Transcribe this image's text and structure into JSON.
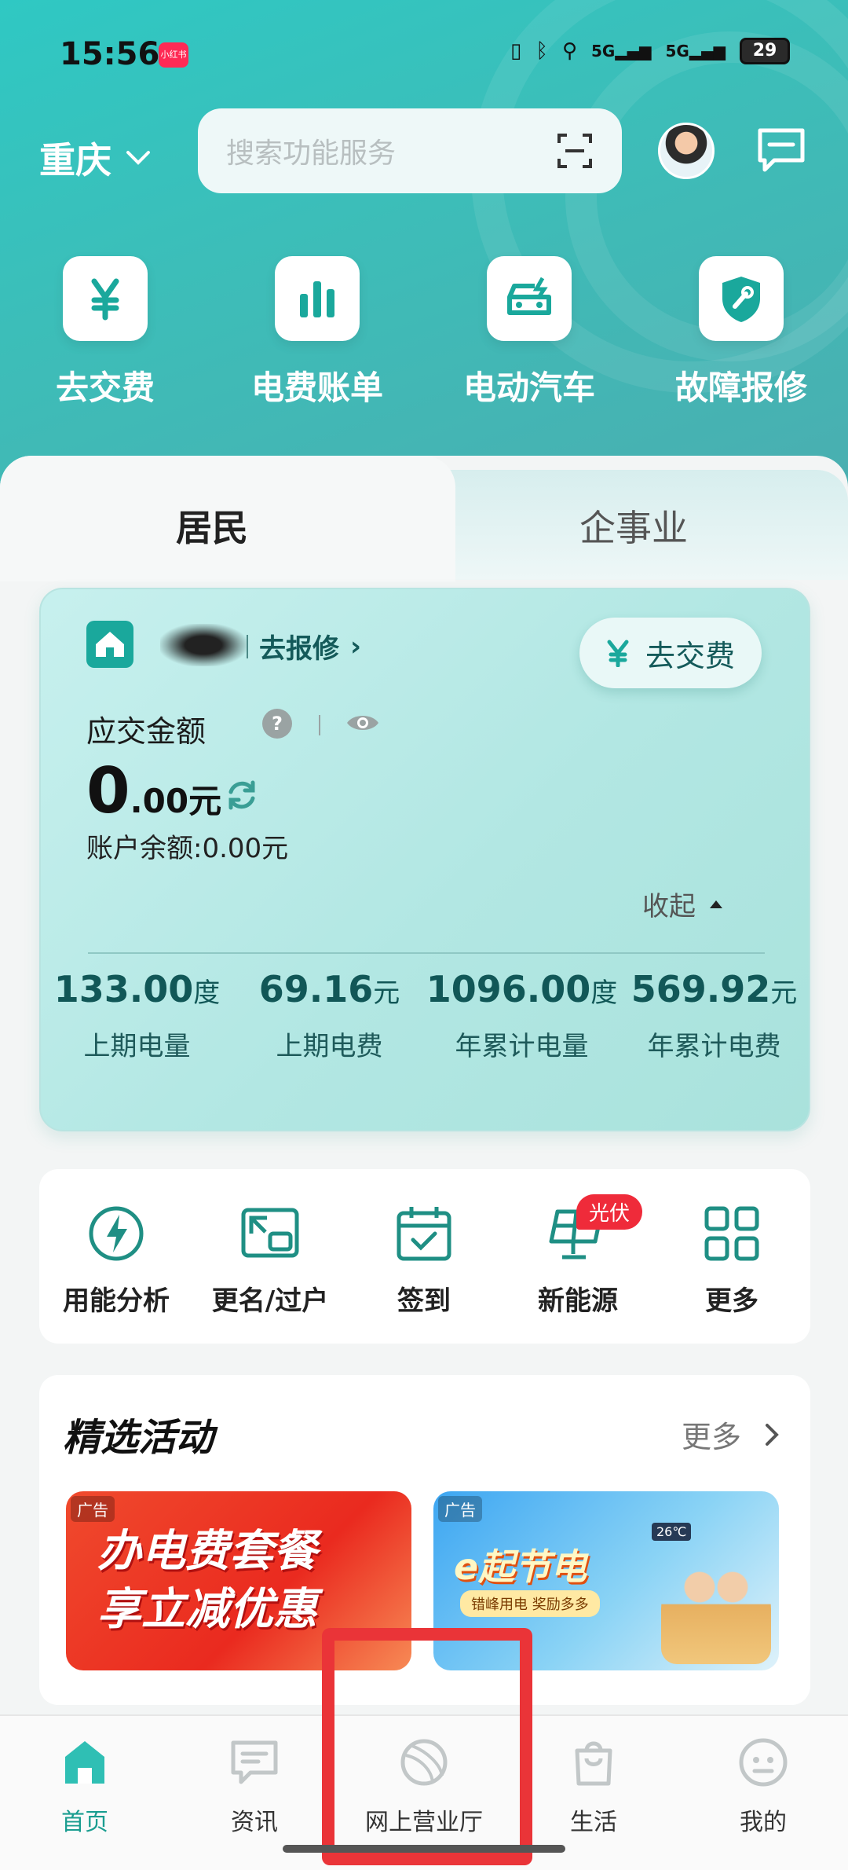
{
  "status_bar": {
    "time": "15:56",
    "app_badge": "小红书",
    "battery": "29",
    "signal_1": "5G",
    "signal_2": "5G"
  },
  "header": {
    "city": "重庆",
    "search_placeholder": "搜索功能服务"
  },
  "quick_actions": [
    {
      "label": "去交费",
      "icon": "yen-icon"
    },
    {
      "label": "电费账单",
      "icon": "bar-chart-icon"
    },
    {
      "label": "电动汽车",
      "icon": "ev-car-icon"
    },
    {
      "label": "故障报修",
      "icon": "wrench-shield-icon"
    }
  ],
  "tabs": {
    "resident": "居民",
    "enterprise": "企事业"
  },
  "account": {
    "repair_link": "去报修",
    "pay_button": "去交费",
    "due_label": "应交金额",
    "help_glyph": "?",
    "amount_int": "0",
    "amount_dec": ".00元",
    "balance": "账户余额:0.00元",
    "collapse": "收起",
    "stats": [
      {
        "value": "133.00",
        "unit": "度",
        "label": "上期电量"
      },
      {
        "value": "69.16",
        "unit": "元",
        "label": "上期电费"
      },
      {
        "value": "1096.00",
        "unit": "度",
        "label": "年累计电量"
      },
      {
        "value": "569.92",
        "unit": "元",
        "label": "年累计电费"
      }
    ]
  },
  "services": [
    {
      "label": "用能分析",
      "icon": "lightning-icon"
    },
    {
      "label": "更名/过户",
      "icon": "transfer-icon"
    },
    {
      "label": "签到",
      "icon": "calendar-check-icon"
    },
    {
      "label": "新能源",
      "icon": "solar-panel-icon",
      "badge": "光伏"
    },
    {
      "label": "更多",
      "icon": "grid-icon"
    }
  ],
  "activities": {
    "title": "精选活动",
    "more": "更多",
    "banners": [
      {
        "ad_tag": "广告",
        "text_line1": "办电费套餐",
        "text_line2": "享立减优惠"
      },
      {
        "ad_tag": "广告",
        "text": "e起节电",
        "subtext": "错峰用电 奖励多多",
        "temp": "26℃"
      }
    ]
  },
  "bottom_nav": [
    {
      "label": "首页",
      "active": true
    },
    {
      "label": "资讯",
      "active": false
    },
    {
      "label": "网上营业厅",
      "active": false
    },
    {
      "label": "生活",
      "active": false
    },
    {
      "label": "我的",
      "active": false
    }
  ],
  "colors": {
    "accent": "#1a9d90",
    "header_teal": "#2fc8c3",
    "highlight_red": "#ea3438"
  }
}
